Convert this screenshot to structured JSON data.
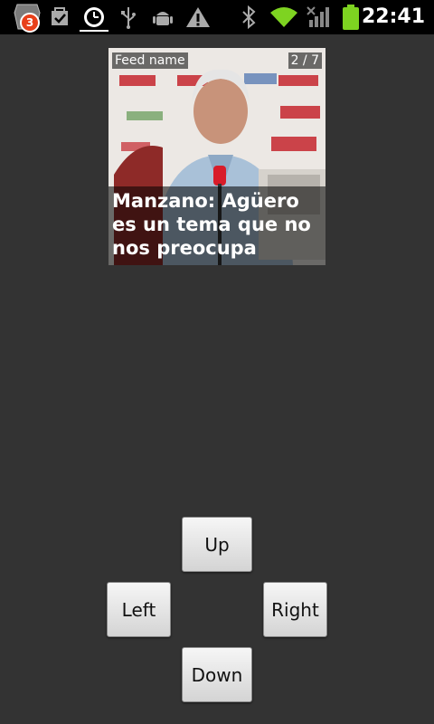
{
  "status_bar": {
    "notification_count": "3",
    "time": "22:41",
    "icons": [
      "notification-icon",
      "checkbox-icon",
      "clock-icon",
      "usb-icon",
      "android-debug-icon",
      "warning-icon",
      "bluetooth-icon",
      "wifi-icon",
      "signal-icon",
      "battery-icon"
    ]
  },
  "feed": {
    "name": "Feed name",
    "position": "2 / 7",
    "headline": "Manzano: Agüero es un tema que no nos preocupa"
  },
  "controls": {
    "up": "Up",
    "left": "Left",
    "right": "Right",
    "down": "Down"
  }
}
